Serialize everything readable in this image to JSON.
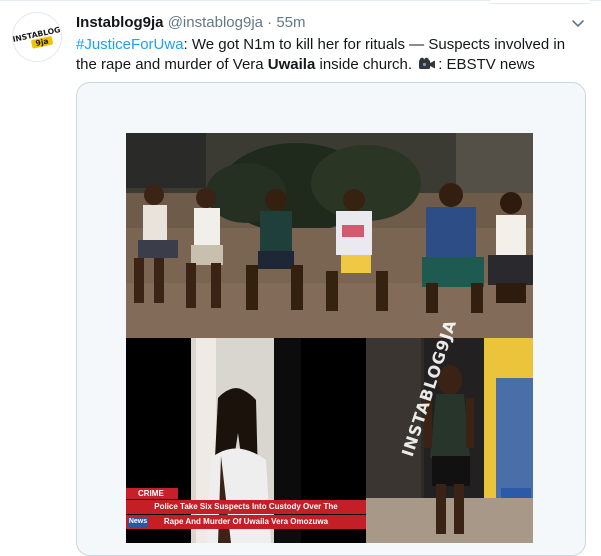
{
  "tweet": {
    "display_name": "Instablog9ja",
    "handle": "@instablog9ja",
    "separator": "·",
    "time": "55m",
    "hashtag": "#JusticeForUwa",
    "text_part1": ": We got N1m to kill her for rituals — Suspects involved in the rape and murder of Vera ",
    "text_bold": "Uwaila",
    "text_part2": " inside church. ",
    "text_part3": ": EBSTV news"
  },
  "avatar": {
    "logo_text": "INSTABLOG9ja"
  },
  "media": {
    "watermark": "INSTABLOG9JA",
    "news_tag": "CRIME",
    "news_line1": "Police Take Six Suspects Into Custody Over The",
    "news_line2": "Rape And Murder Of Uwaila Vera Omozuwa",
    "news_logo": "News"
  },
  "colors": {
    "link": "#1da1f2",
    "muted": "#657786",
    "border": "#ccd6dd",
    "news_red": "#c41f27"
  },
  "icons": {
    "caret": "chevron-down-icon",
    "camera": "video-camera-emoji-icon"
  }
}
